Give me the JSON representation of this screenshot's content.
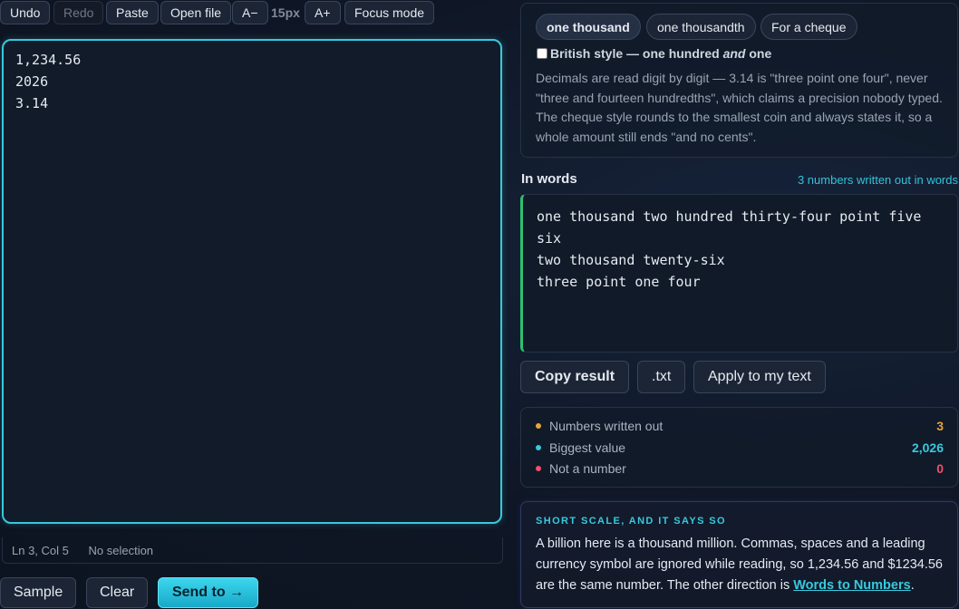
{
  "toolbar": {
    "undo": "Undo",
    "redo": "Redo",
    "paste": "Paste",
    "open_file": "Open file",
    "font_decrease": "A−",
    "font_size": "15px",
    "font_increase": "A+",
    "focus_mode": "Focus mode"
  },
  "editor": {
    "lines": [
      "1,234.56",
      "2026",
      "3.14"
    ]
  },
  "status": {
    "position": "Ln 3, Col 5",
    "selection": "No selection"
  },
  "bottom_buttons": {
    "sample": "Sample",
    "clear": "Clear",
    "send_to": "Send to →"
  },
  "options": {
    "styles": [
      "one thousand",
      "one thousandth",
      "For a cheque"
    ],
    "active_style": "one thousand",
    "british": {
      "checked": false,
      "label_before": "British style — one hundred ",
      "label_em": "and",
      "label_after": " one"
    },
    "explanation": "Decimals are read digit by digit — 3.14 is \"three point one four\", never \"three and fourteen hundredths\", which claims a precision nobody typed. The cheque style rounds to the smallest coin and always states it, so a whole amount still ends \"and no cents\"."
  },
  "in_words": {
    "title": "In words",
    "count_label": "3 numbers written out in words",
    "output": "one thousand two hundred thirty-four point five six\ntwo thousand twenty-six\nthree point one four"
  },
  "actions": {
    "copy": "Copy result",
    "txt": ".txt",
    "apply": "Apply to my text"
  },
  "stats": [
    {
      "label": "Numbers written out",
      "value": "3",
      "color": "#e8a33a"
    },
    {
      "label": "Biggest value",
      "value": "2,026",
      "color": "#38c9dd"
    },
    {
      "label": "Not a number",
      "value": "0",
      "color": "#f0506e"
    }
  ],
  "info": {
    "heading": "SHORT SCALE, AND IT SAYS SO",
    "body": "A billion here is a thousand million. Commas, spaces and a leading currency symbol are ignored while reading, so 1,234.56 and $1234.56 are the same number. The other direction is ",
    "link": "Words to Numbers",
    "body_end": "."
  }
}
